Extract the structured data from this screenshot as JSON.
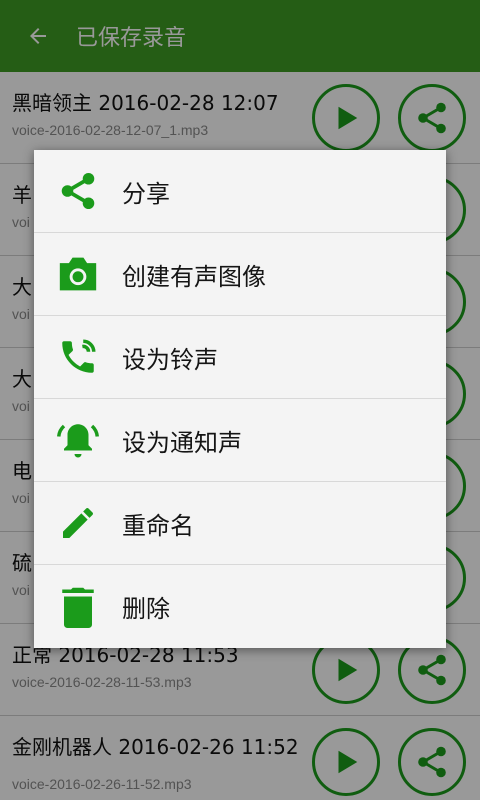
{
  "appbar": {
    "title": "已保存录音"
  },
  "recordings": [
    {
      "title": "黑暗领主 2016-02-28 12:07",
      "file": "voice-2016-02-28-12-07_1.mp3"
    },
    {
      "title": "羊",
      "file": "voi"
    },
    {
      "title": "大",
      "file": "voi"
    },
    {
      "title": "大",
      "file": "voi"
    },
    {
      "title": "电",
      "file": "voi"
    },
    {
      "title": "硫",
      "file": "voi"
    },
    {
      "title": "正常 2016-02-28 11:53",
      "file": "voice-2016-02-28-11-53.mp3"
    },
    {
      "title": "金刚机器人 2016-02-26 11:52",
      "file": "voice-2016-02-26-11-52.mp3"
    }
  ],
  "menu": {
    "items": [
      {
        "label": "分享",
        "icon": "share-icon"
      },
      {
        "label": "创建有声图像",
        "icon": "camera-icon"
      },
      {
        "label": "设为铃声",
        "icon": "phone-ringing-icon"
      },
      {
        "label": "设为通知声",
        "icon": "bell-ringing-icon"
      },
      {
        "label": "重命名",
        "icon": "pencil-icon"
      },
      {
        "label": "删除",
        "icon": "trash-icon"
      }
    ]
  },
  "colors": {
    "accent": "#1b9b1b",
    "appbar": "#3f9b24",
    "scrim": "rgba(0,0,0,0.40)"
  }
}
